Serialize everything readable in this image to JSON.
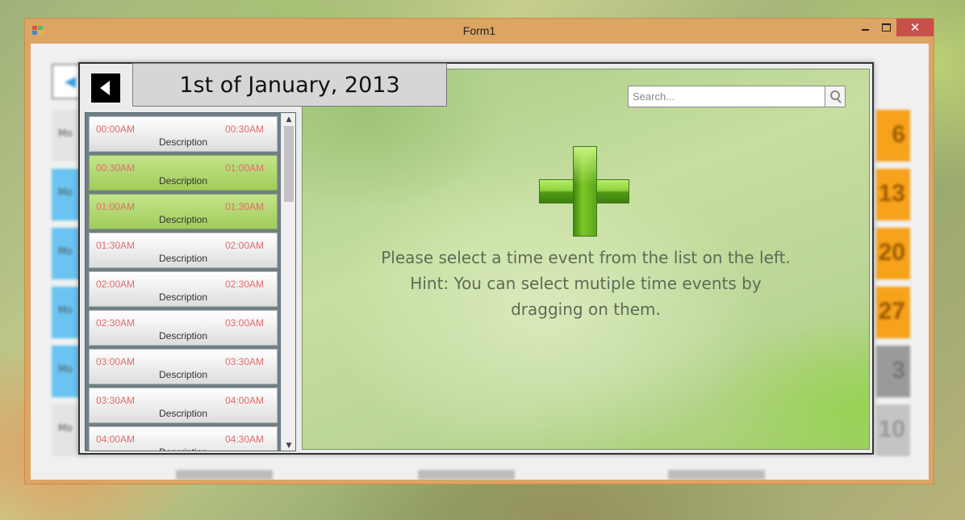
{
  "window": {
    "title": "Form1",
    "close_glyph": "✕"
  },
  "background_calendar": {
    "day_label": "Mo",
    "numbers": [
      "6",
      "13",
      "20",
      "27",
      "3",
      "10"
    ]
  },
  "popup": {
    "date_title": "1st of January, 2013",
    "slots": [
      {
        "start": "00:00AM",
        "end": "00:30AM",
        "description": "Description",
        "selected": false
      },
      {
        "start": "00:30AM",
        "end": "01:00AM",
        "description": "Description",
        "selected": true
      },
      {
        "start": "01:00AM",
        "end": "01:30AM",
        "description": "Description",
        "selected": true
      },
      {
        "start": "01:30AM",
        "end": "02:00AM",
        "description": "Description",
        "selected": false
      },
      {
        "start": "02:00AM",
        "end": "02:30AM",
        "description": "Description",
        "selected": false
      },
      {
        "start": "02:30AM",
        "end": "03:00AM",
        "description": "Description",
        "selected": false
      },
      {
        "start": "03:00AM",
        "end": "03:30AM",
        "description": "Description",
        "selected": false
      },
      {
        "start": "03:30AM",
        "end": "04:00AM",
        "description": "Description",
        "selected": false
      },
      {
        "start": "04:00AM",
        "end": "04:30AM",
        "description": "Description",
        "selected": false
      }
    ],
    "search": {
      "placeholder": "Search..."
    },
    "hint": {
      "line1": "Please select a time event from the list on the left.",
      "line2": "Hint: You can select mutiple time events by",
      "line3": "dragging on them."
    },
    "scrollbar": {
      "up_glyph": "▲",
      "down_glyph": "▼"
    }
  },
  "colors": {
    "window_frame": "#dca563",
    "close_button": "#c7504a",
    "slot_time": "#e36b6b",
    "slot_selected": "#a8d163",
    "bg_blue_day": "#69c4f2",
    "bg_orange_number": "#f7a21b",
    "bg_gray_number": "#9a9a9a"
  },
  "icons": {
    "back": "back-arrow-icon",
    "search": "magnifier-icon",
    "add": "green-plus-icon"
  }
}
